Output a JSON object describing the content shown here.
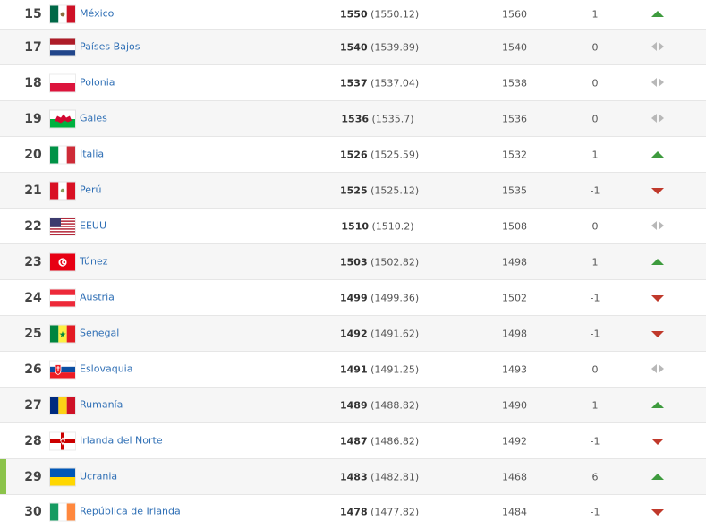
{
  "rows": [
    {
      "rank": "15",
      "country": "México",
      "points_main": "1550",
      "points_exact": "(1550.12)",
      "prev": "1560",
      "change": "1",
      "trend": "up",
      "flag": "mexico-flag-icon"
    },
    {
      "rank": "17",
      "country": "Países Bajos",
      "points_main": "1540",
      "points_exact": "(1539.89)",
      "prev": "1540",
      "change": "0",
      "trend": "same",
      "flag": "netherlands-flag-icon"
    },
    {
      "rank": "18",
      "country": "Polonia",
      "points_main": "1537",
      "points_exact": "(1537.04)",
      "prev": "1538",
      "change": "0",
      "trend": "same",
      "flag": "poland-flag-icon"
    },
    {
      "rank": "19",
      "country": "Gales",
      "points_main": "1536",
      "points_exact": "(1535.7)",
      "prev": "1536",
      "change": "0",
      "trend": "same",
      "flag": "wales-flag-icon"
    },
    {
      "rank": "20",
      "country": "Italia",
      "points_main": "1526",
      "points_exact": "(1525.59)",
      "prev": "1532",
      "change": "1",
      "trend": "up",
      "flag": "italy-flag-icon"
    },
    {
      "rank": "21",
      "country": "Perú",
      "points_main": "1525",
      "points_exact": "(1525.12)",
      "prev": "1535",
      "change": "-1",
      "trend": "down",
      "flag": "peru-flag-icon"
    },
    {
      "rank": "22",
      "country": "EEUU",
      "points_main": "1510",
      "points_exact": "(1510.2)",
      "prev": "1508",
      "change": "0",
      "trend": "same",
      "flag": "usa-flag-icon"
    },
    {
      "rank": "23",
      "country": "Túnez",
      "points_main": "1503",
      "points_exact": "(1502.82)",
      "prev": "1498",
      "change": "1",
      "trend": "up",
      "flag": "tunisia-flag-icon"
    },
    {
      "rank": "24",
      "country": "Austria",
      "points_main": "1499",
      "points_exact": "(1499.36)",
      "prev": "1502",
      "change": "-1",
      "trend": "down",
      "flag": "austria-flag-icon"
    },
    {
      "rank": "25",
      "country": "Senegal",
      "points_main": "1492",
      "points_exact": "(1491.62)",
      "prev": "1498",
      "change": "-1",
      "trend": "down",
      "flag": "senegal-flag-icon"
    },
    {
      "rank": "26",
      "country": "Eslovaquia",
      "points_main": "1491",
      "points_exact": "(1491.25)",
      "prev": "1493",
      "change": "0",
      "trend": "same",
      "flag": "slovakia-flag-icon"
    },
    {
      "rank": "27",
      "country": "Rumanía",
      "points_main": "1489",
      "points_exact": "(1488.82)",
      "prev": "1490",
      "change": "1",
      "trend": "up",
      "flag": "romania-flag-icon"
    },
    {
      "rank": "28",
      "country": "Irlanda del Norte",
      "points_main": "1487",
      "points_exact": "(1486.82)",
      "prev": "1492",
      "change": "-1",
      "trend": "down",
      "flag": "northern-ireland-flag-icon"
    },
    {
      "rank": "29",
      "country": "Ucrania",
      "points_main": "1483",
      "points_exact": "(1482.81)",
      "prev": "1468",
      "change": "6",
      "trend": "up",
      "flag": "ukraine-flag-icon"
    },
    {
      "rank": "30",
      "country": "República de Irlanda",
      "points_main": "1478",
      "points_exact": "(1477.82)",
      "prev": "1484",
      "change": "-1",
      "trend": "down",
      "flag": "ireland-flag-icon"
    }
  ],
  "colors": {
    "link": "#2f6fb5",
    "up": "#3e9b3e",
    "down": "#c0392b",
    "same": "#b8b8b8",
    "highlight": "#8bc34a"
  }
}
